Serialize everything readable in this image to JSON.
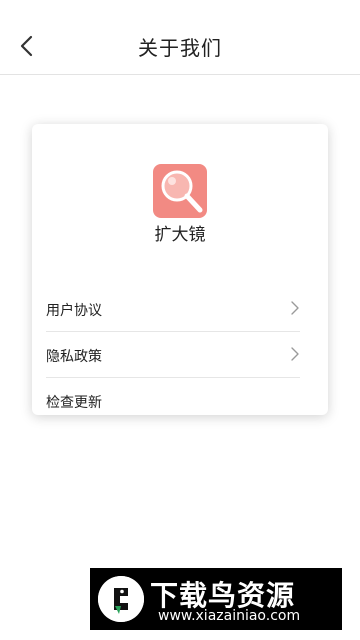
{
  "header": {
    "back_icon": "chevron-left-icon",
    "title": "关于我们"
  },
  "app": {
    "icon": "magnifier-icon",
    "icon_color": "#f28a83",
    "name": "扩大镜"
  },
  "menu": {
    "items": [
      {
        "label": "用户协议",
        "icon": "chevron-right-icon"
      },
      {
        "label": "隐私政策",
        "icon": "chevron-right-icon"
      },
      {
        "label": "检查更新"
      }
    ]
  },
  "watermark": {
    "logo_icon": "bird-logo-icon",
    "brand": "下载鸟资源",
    "url": "www.xiazainiao.com"
  }
}
